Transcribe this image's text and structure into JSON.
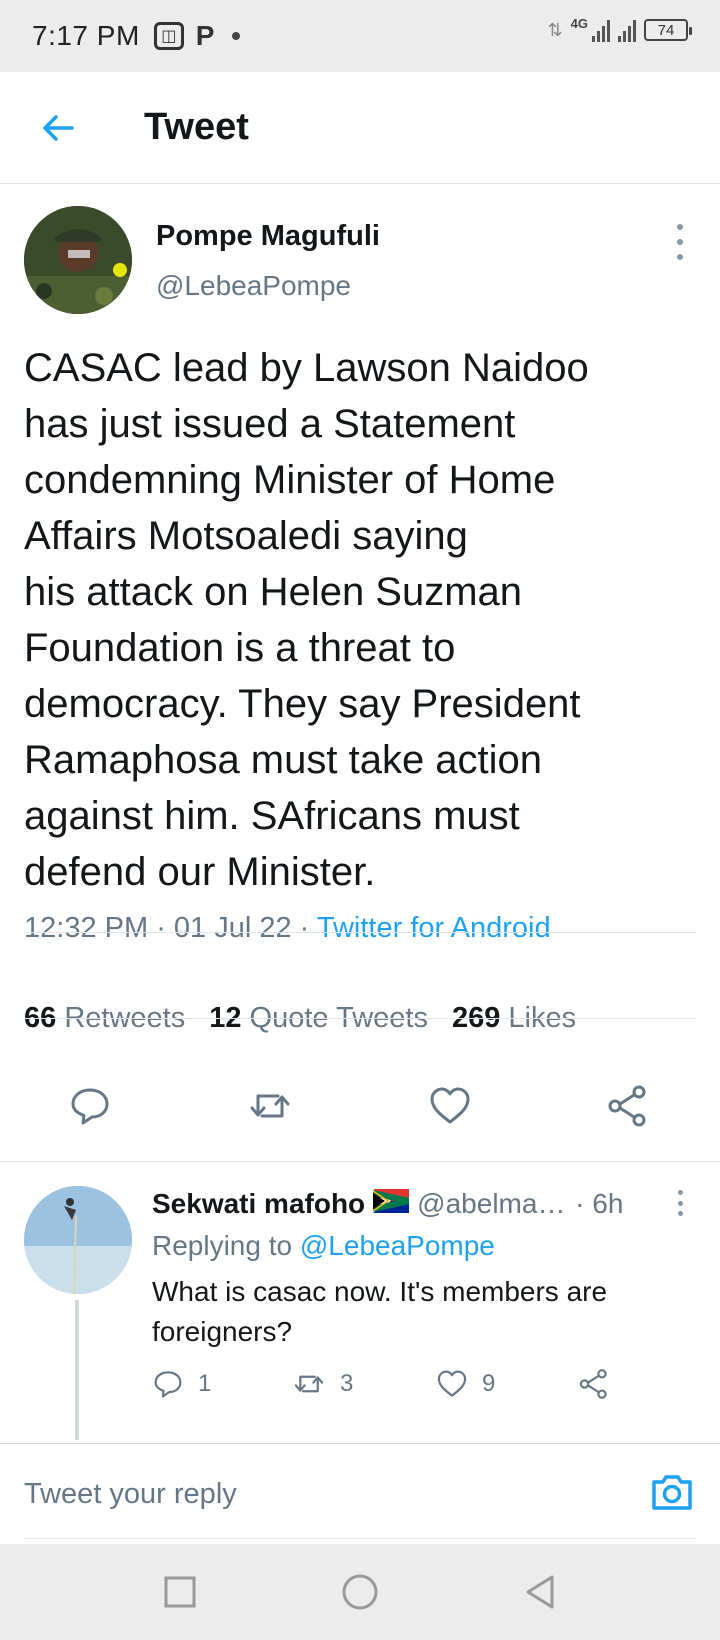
{
  "status_bar": {
    "time": "7:17 PM",
    "p_icon": "P",
    "network": "4G",
    "battery": "74"
  },
  "header": {
    "title": "Tweet",
    "back_icon": "arrow-left-icon"
  },
  "tweet": {
    "author_name": "Pompe Magufuli",
    "author_handle": "@LebeaPompe",
    "text": "CASAC lead by Lawson Naidoo\nhas just  issued  a Statement\ncondemning Minister of Home\nAffairs Motsoaledi saying\nhis attack  on Helen Suzman\nFoundation is a threat  to\ndemocracy.  They  say President\nRamaphosa must take action\nagainst him. SAfricans must\ndefend our Minister.",
    "time": "12:32 PM",
    "date": "01 Jul 22",
    "source": "Twitter for Android",
    "separator": " · ",
    "retweets_count": "66",
    "retweets_label": "Retweets",
    "quote_count": "12",
    "quote_label": "Quote Tweets",
    "likes_count": "269",
    "likes_label": "Likes"
  },
  "reply": {
    "author_name": "Sekwati mafoho",
    "author_handle": "@abelmaf...",
    "time": "· 6h",
    "replying_prefix": "Replying to",
    "replying_to": "@LebeaPompe",
    "text": "What is casac now. It's members are foreigners?",
    "reply_count": "1",
    "retweet_count": "3",
    "like_count": "9"
  },
  "compose": {
    "placeholder": "Tweet your reply"
  },
  "colors": {
    "accent": "#1da1f2",
    "muted": "#657786",
    "text": "#14171a"
  }
}
